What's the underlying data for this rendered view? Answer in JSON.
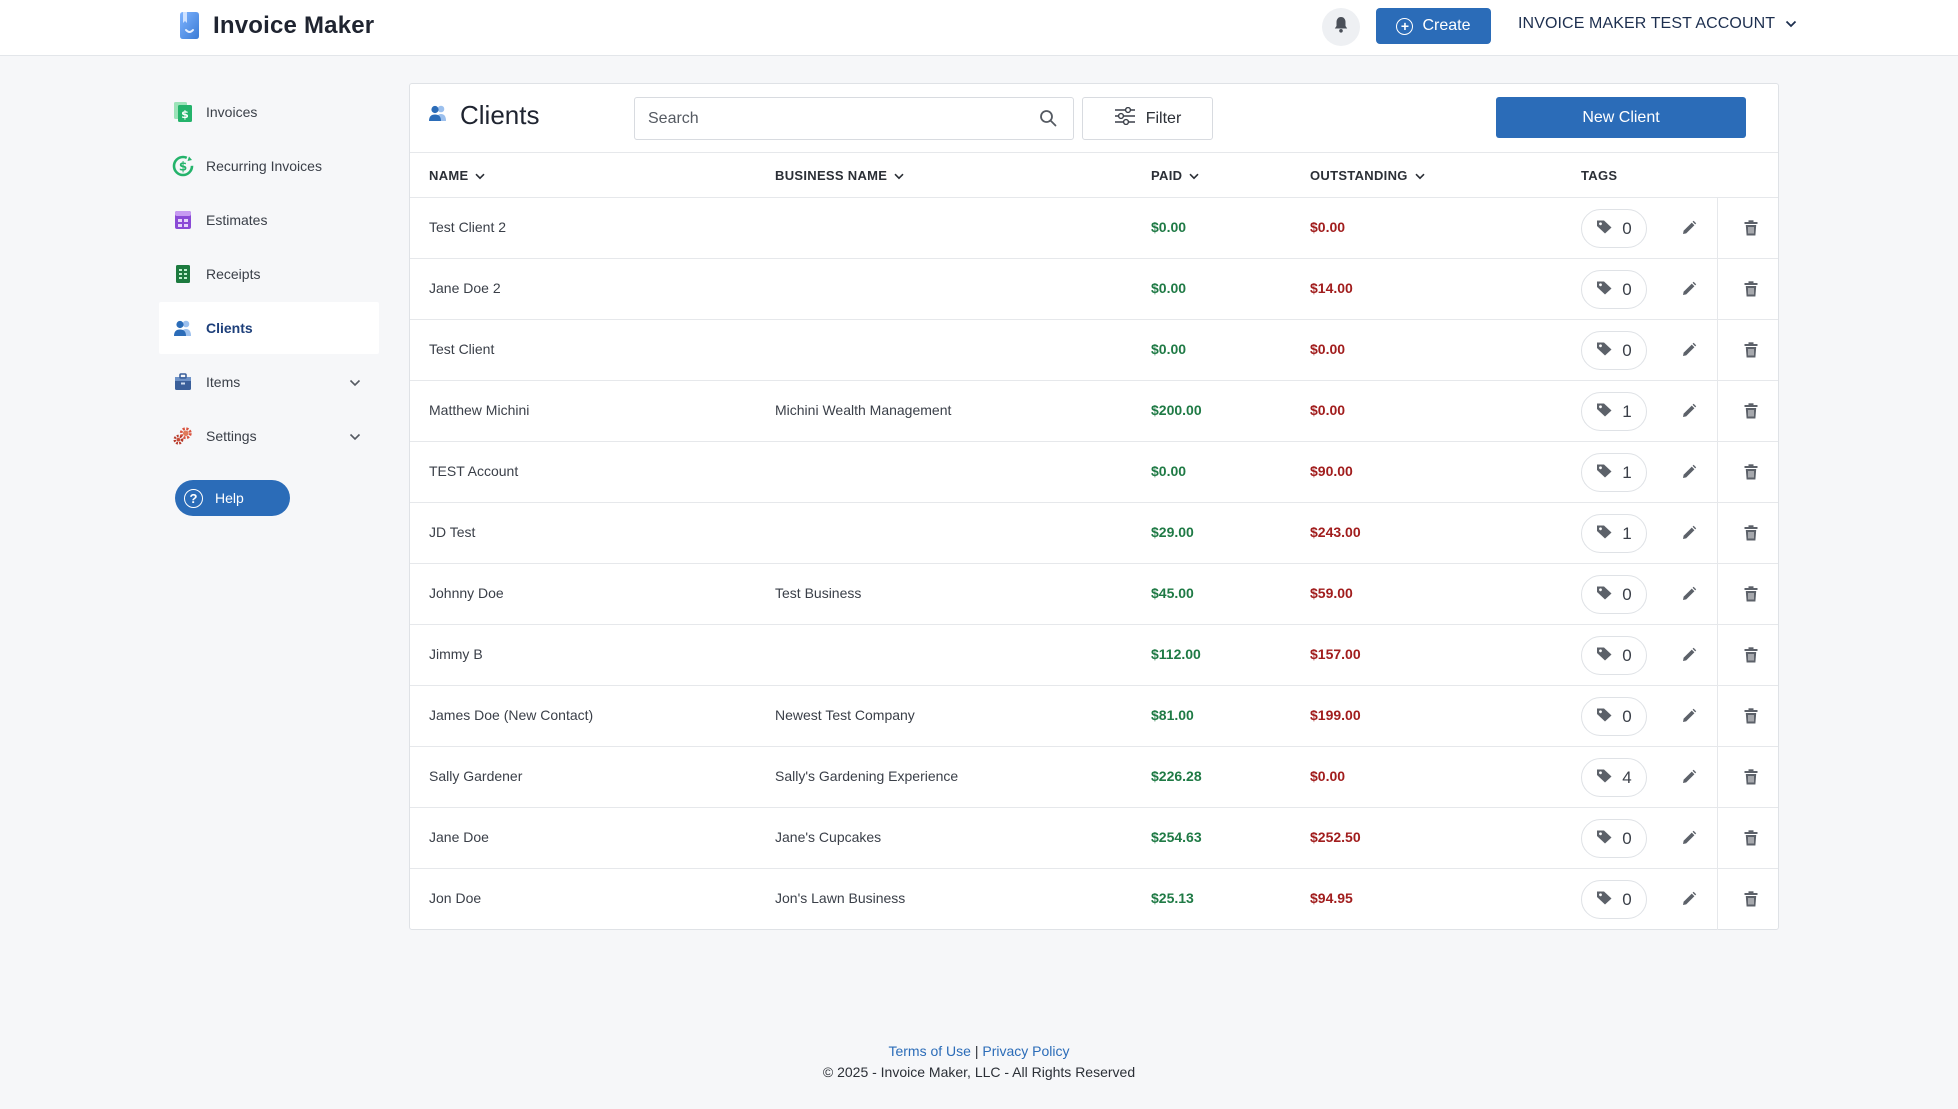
{
  "header": {
    "brand_name": "Invoice Maker",
    "create_label": "Create",
    "account_name": "INVOICE MAKER TEST ACCOUNT"
  },
  "sidebar": {
    "items": [
      {
        "label": "Invoices",
        "icon": "invoice-icon",
        "active": false
      },
      {
        "label": "Recurring Invoices",
        "icon": "recurring-icon",
        "active": false
      },
      {
        "label": "Estimates",
        "icon": "estimates-icon",
        "active": false
      },
      {
        "label": "Receipts",
        "icon": "receipts-icon",
        "active": false
      },
      {
        "label": "Clients",
        "icon": "clients-icon",
        "active": true
      },
      {
        "label": "Items",
        "icon": "items-icon",
        "active": false
      },
      {
        "label": "Settings",
        "icon": "gear-icon",
        "active": false
      }
    ],
    "help_label": "Help"
  },
  "main": {
    "title": "Clients",
    "search_placeholder": "Search",
    "filter_label": "Filter",
    "new_client_label": "New Client",
    "columns": [
      "NAME",
      "BUSINESS NAME",
      "PAID",
      "OUTSTANDING",
      "TAGS"
    ],
    "rows": [
      {
        "name": "Test Client 2",
        "business": "",
        "paid": "$0.00",
        "outstanding": "$0.00",
        "tags": "0"
      },
      {
        "name": "Jane Doe 2",
        "business": "",
        "paid": "$0.00",
        "outstanding": "$14.00",
        "tags": "0"
      },
      {
        "name": "Test Client",
        "business": "",
        "paid": "$0.00",
        "outstanding": "$0.00",
        "tags": "0"
      },
      {
        "name": "Matthew Michini",
        "business": "Michini Wealth Management",
        "paid": "$200.00",
        "outstanding": "$0.00",
        "tags": "1"
      },
      {
        "name": "TEST Account",
        "business": "",
        "paid": "$0.00",
        "outstanding": "$90.00",
        "tags": "1"
      },
      {
        "name": "JD Test",
        "business": "",
        "paid": "$29.00",
        "outstanding": "$243.00",
        "tags": "1"
      },
      {
        "name": "Johnny Doe",
        "business": "Test Business",
        "paid": "$45.00",
        "outstanding": "$59.00",
        "tags": "0"
      },
      {
        "name": "Jimmy B",
        "business": "",
        "paid": "$112.00",
        "outstanding": "$157.00",
        "tags": "0"
      },
      {
        "name": "James Doe (New Contact)",
        "business": "Newest Test Company",
        "paid": "$81.00",
        "outstanding": "$199.00",
        "tags": "0"
      },
      {
        "name": "Sally Gardener",
        "business": "Sally's Gardening Experience",
        "paid": "$226.28",
        "outstanding": "$0.00",
        "tags": "4"
      },
      {
        "name": "Jane Doe",
        "business": "Jane's Cupcakes",
        "paid": "$254.63",
        "outstanding": "$252.50",
        "tags": "0"
      },
      {
        "name": "Jon Doe",
        "business": "Jon's Lawn Business",
        "paid": "$25.13",
        "outstanding": "$94.95",
        "tags": "0"
      }
    ]
  },
  "footer": {
    "terms_label": "Terms of Use",
    "separator": "|",
    "privacy_label": "Privacy Policy",
    "copyright": "© 2025 - Invoice Maker, LLC - All Rights Reserved"
  },
  "colors": {
    "primary": "#2b6cb8",
    "paid": "#1f7a45",
    "outstanding": "#a11d1d"
  }
}
